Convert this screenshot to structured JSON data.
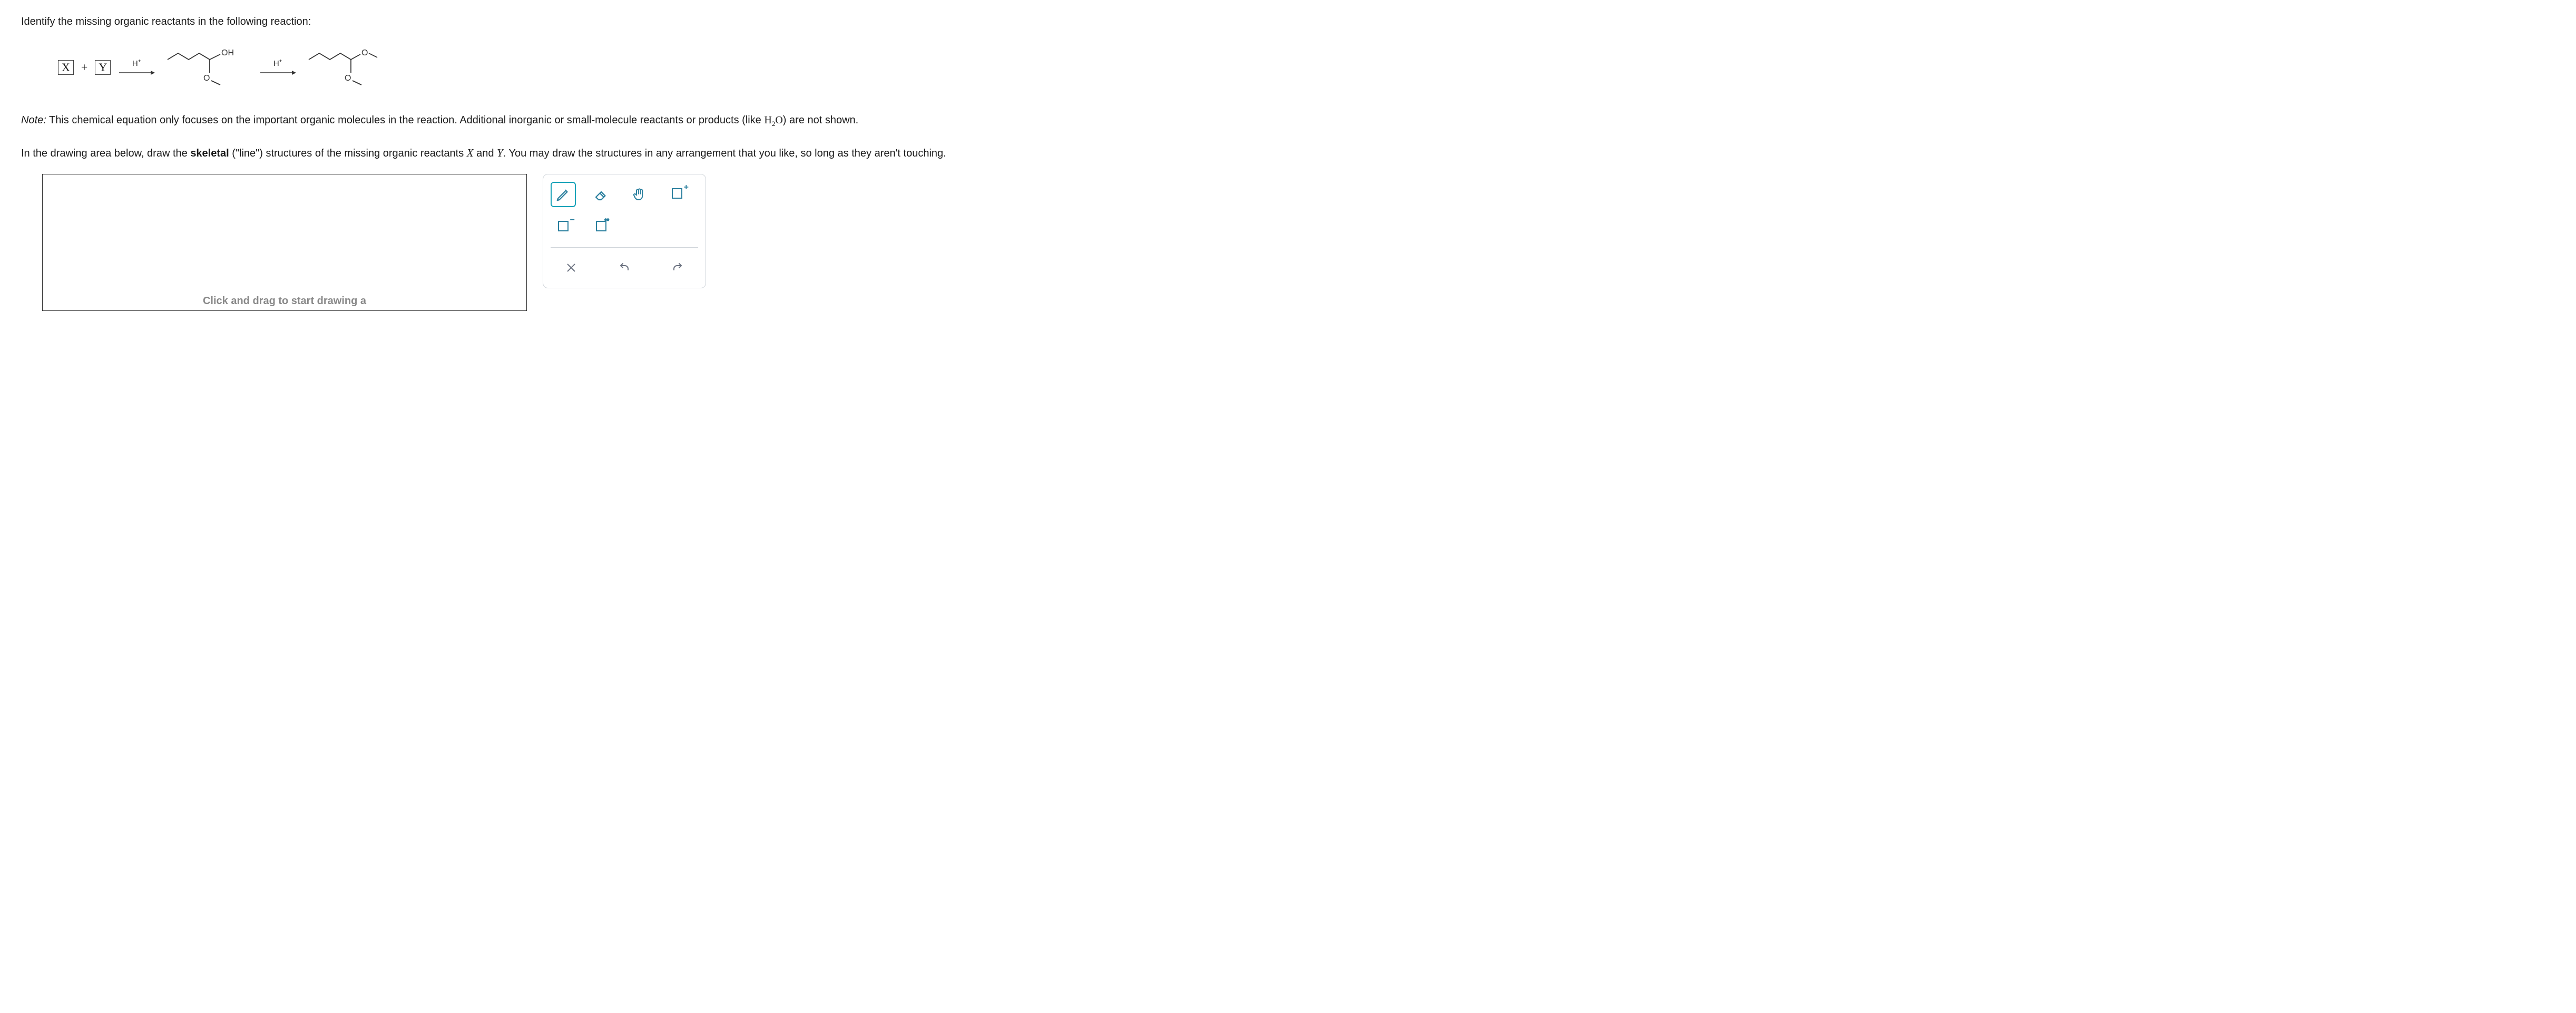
{
  "question": "Identify the missing organic reactants in the following reaction:",
  "reaction": {
    "reagent_x": "X",
    "plus": "+",
    "reagent_y": "Y",
    "arrow1_condition": "H",
    "arrow1_sup": "+",
    "intermediate_OH": "OH",
    "intermediate_O": "O",
    "arrow2_condition": "H",
    "arrow2_sup": "+",
    "product_O1": "O",
    "product_O2": "O"
  },
  "note_label": "Note:",
  "note_body_1": " This chemical equation only focuses on the important organic molecules in the reaction. Additional inorganic or small-molecule reactants or products (like ",
  "note_formula": "H",
  "note_sub": "2",
  "note_formula2": "O",
  "note_body_2": ") are not shown.",
  "instr_1": "In the drawing area below, draw the ",
  "instr_bold": "skeletal",
  "instr_2": " (\"line\") structures of the missing organic reactants ",
  "instr_varX": "X",
  "instr_and": " and ",
  "instr_varY": "Y",
  "instr_3": ". You may draw the structures in any arrangement that you like, so long as they aren't touching.",
  "canvas_hint": "Click and drag to start drawing a",
  "tools": {
    "pencil": "pencil-icon",
    "eraser": "eraser-icon",
    "hand": "hand-icon",
    "add_charge_plus": "+",
    "add_charge_minus": "−",
    "clear": "clear",
    "undo": "undo",
    "redo": "redo"
  }
}
